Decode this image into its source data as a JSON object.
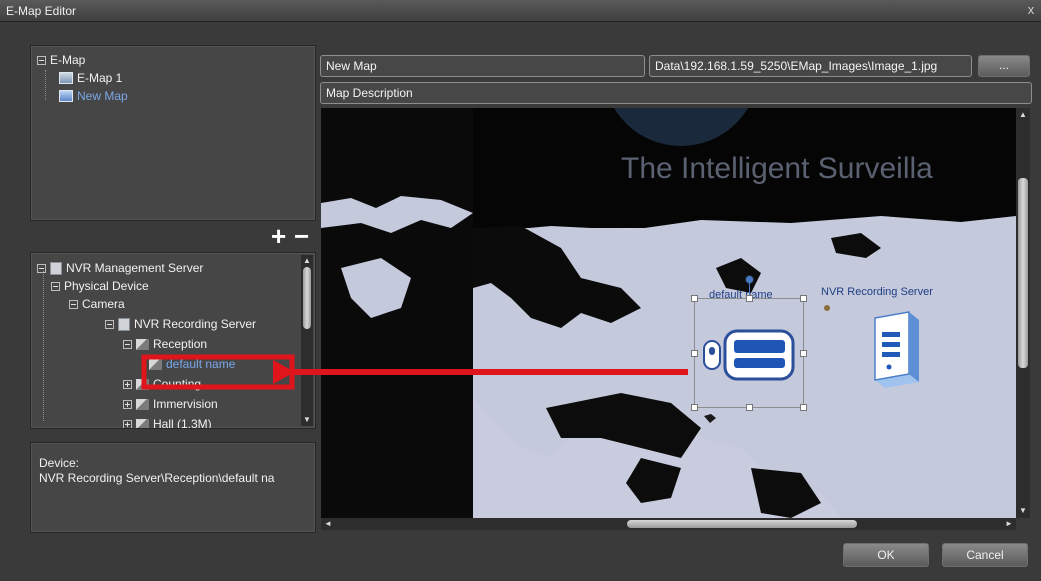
{
  "window": {
    "title": "E-Map Editor",
    "close_glyph": "x"
  },
  "map_tree": {
    "root": "E-Map",
    "items": [
      {
        "label": "E-Map 1",
        "icon": "map-icon"
      },
      {
        "label": "New Map",
        "icon": "map-icon",
        "selected": true
      }
    ]
  },
  "tree_controls": {
    "add": "+",
    "remove": "−"
  },
  "device_tree": {
    "nodes": [
      {
        "label": "NVR Management Server",
        "icon": "server-icon"
      },
      {
        "label": "Physical Device"
      },
      {
        "label": "Camera"
      },
      {
        "label": "NVR Recording Server",
        "icon": "recording-server-icon"
      },
      {
        "label": "Reception",
        "icon": "camera-icon"
      },
      {
        "label": "default name",
        "icon": "camera-icon"
      },
      {
        "label": "Counting",
        "icon": "camera-icon"
      },
      {
        "label": "Immervision",
        "icon": "camera-icon"
      },
      {
        "label": "Hall (1.3M)",
        "icon": "camera-icon"
      }
    ]
  },
  "device_info": {
    "label": "Device:",
    "path": "NVR Recording Server\\Reception\\default na"
  },
  "map_name": {
    "value": "New Map"
  },
  "map_image_path": {
    "value": "Data\\192.168.1.59_5250\\EMap_Images\\Image_1.jpg"
  },
  "browse_button": {
    "label": "..."
  },
  "map_description": {
    "value": "Map Description"
  },
  "map_canvas": {
    "banner_text": "The Intelligent Surveilla",
    "devices": [
      {
        "label": "default name",
        "icon": "camera-device-icon",
        "selected": true
      },
      {
        "label": "NVR Recording Server",
        "icon": "nvr-server-icon"
      }
    ]
  },
  "annotation": {
    "color": "#e0141b"
  },
  "buttons": {
    "ok": "OK",
    "cancel": "Cancel"
  }
}
